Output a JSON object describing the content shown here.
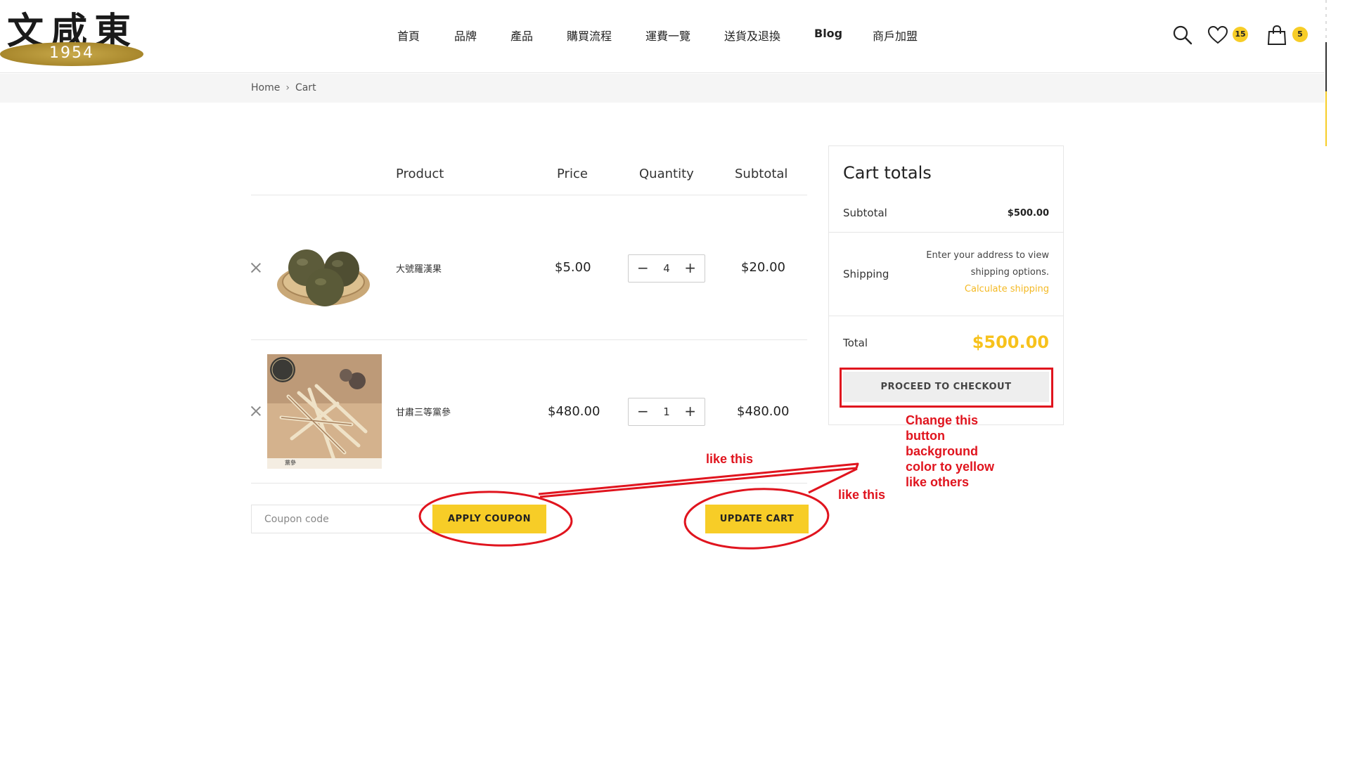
{
  "logo": {
    "chars": "文咸東",
    "year": "1954"
  },
  "nav": [
    {
      "label": "首頁"
    },
    {
      "label": "品牌"
    },
    {
      "label": "產品"
    },
    {
      "label": "購買流程"
    },
    {
      "label": "運費一覽"
    },
    {
      "label": "送貨及退換"
    },
    {
      "label": "Blog"
    },
    {
      "label": "商戶加盟"
    }
  ],
  "header_icons": {
    "search": "search-icon",
    "wishlist": "heart-icon",
    "wishlist_count": "15",
    "cart": "shopping-bag-icon",
    "cart_count": "5",
    "badge_color": "#f7cd27"
  },
  "breadcrumb": {
    "home": "Home",
    "separator": "›",
    "current": "Cart"
  },
  "table": {
    "headers": {
      "product": "Product",
      "price": "Price",
      "quantity": "Quantity",
      "subtotal": "Subtotal"
    },
    "rows": [
      {
        "name": "大號羅漢果",
        "price": "$5.00",
        "quantity": "4",
        "subtotal": "$20.00"
      },
      {
        "name": "甘肅三等黨參",
        "price": "$480.00",
        "quantity": "1",
        "subtotal": "$480.00",
        "image_text": "黨參"
      }
    ],
    "qty_minus": "−",
    "qty_plus": "+"
  },
  "coupon": {
    "placeholder": "Coupon code",
    "apply_label": "APPLY COUPON"
  },
  "update_cart_label": "UPDATE CART",
  "totals": {
    "title": "Cart totals",
    "subtotal_label": "Subtotal",
    "subtotal_value": "$500.00",
    "shipping_label": "Shipping",
    "shipping_line1": "Enter your address to view",
    "shipping_line2": "shipping options.",
    "calc_shipping": "Calculate shipping",
    "total_label": "Total",
    "total_value": "$500.00",
    "checkout_label": "PROCEED TO CHECKOUT"
  },
  "annotations": {
    "note_lines": [
      "Change this",
      "button",
      "background",
      "color to yellow",
      "like others"
    ],
    "like_this_1": "like this",
    "like_this_2": "like this",
    "color": "#e0141e"
  },
  "colors": {
    "accent": "#f7cd27",
    "checkout_bg": "#eeeeee",
    "link": "#f4b923"
  }
}
